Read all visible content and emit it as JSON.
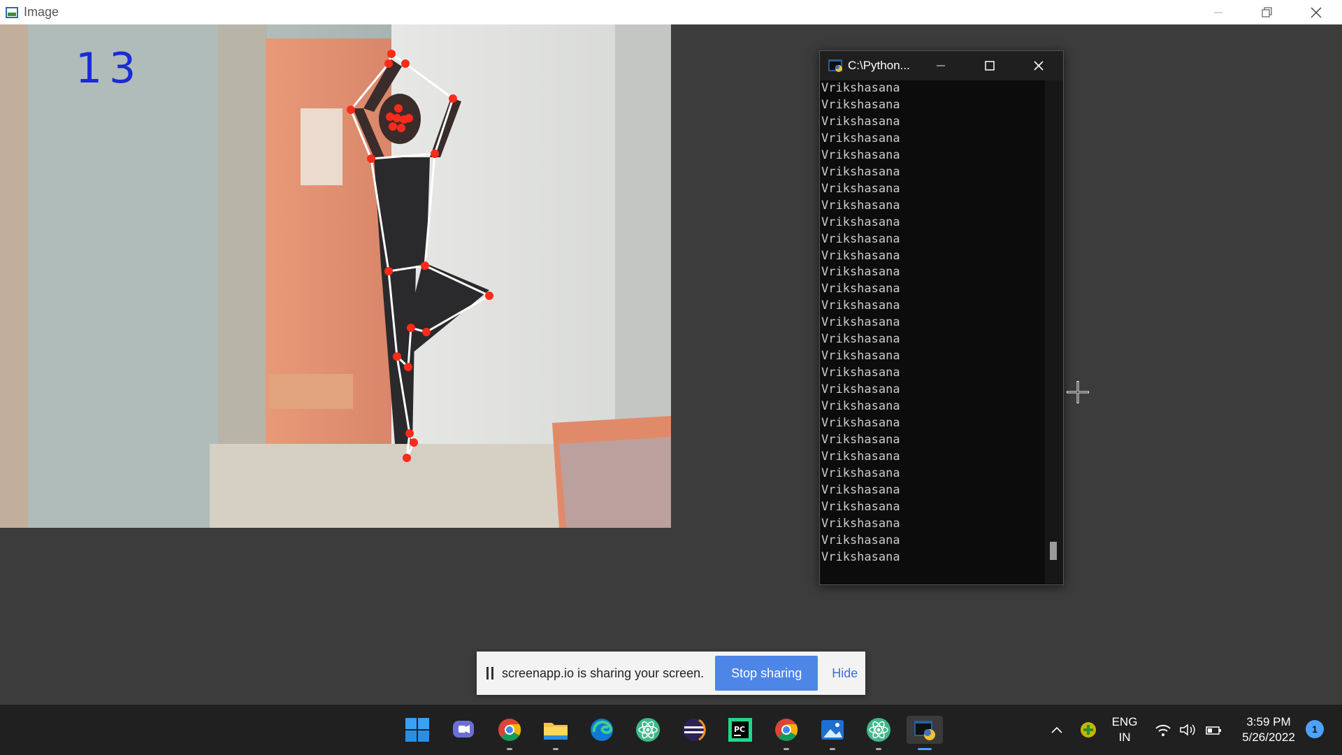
{
  "window": {
    "title": "Image",
    "icon": "image-window-icon",
    "controls": [
      "minimize-icon",
      "restore-icon",
      "close-icon"
    ]
  },
  "camera": {
    "counter": "13",
    "icon": "pose-skeleton-overlay"
  },
  "console": {
    "title": "C:\\Python...",
    "icon": "python-console-icon",
    "lines": [
      "Vrikshasana",
      "Vrikshasana",
      "Vrikshasana",
      "Vrikshasana",
      "Vrikshasana",
      "Vrikshasana",
      "Vrikshasana",
      "Vrikshasana",
      "Vrikshasana",
      "Vrikshasana",
      "Vrikshasana",
      "Vrikshasana",
      "Vrikshasana",
      "Vrikshasana",
      "Vrikshasana",
      "Vrikshasana",
      "Vrikshasana",
      "Vrikshasana",
      "Vrikshasana",
      "Vrikshasana",
      "Vrikshasana",
      "Vrikshasana",
      "Vrikshasana",
      "Vrikshasana",
      "Vrikshasana",
      "Vrikshasana",
      "Vrikshasana",
      "Vrikshasana",
      "Vrikshasana"
    ]
  },
  "share_banner": {
    "text": "screenapp.io is sharing your screen.",
    "stop_label": "Stop sharing",
    "hide_label": "Hide"
  },
  "taskbar": {
    "apps": [
      "windows-start-icon",
      "teams-chat-icon",
      "chrome-icon",
      "file-explorer-icon",
      "edge-icon",
      "atom-icon",
      "eclipse-icon",
      "pycharm-icon",
      "chrome-icon",
      "photos-icon",
      "atom-icon",
      "python-icon"
    ],
    "lang_line1": "ENG",
    "lang_line2": "IN",
    "time": "3:59 PM",
    "date": "5/26/2022",
    "notification_count": "1"
  },
  "colors": {
    "counter": "#1a2bd6",
    "skeleton_joint": "#ff2a1a",
    "skeleton_line": "#ffffff",
    "stop_button": "#4e86e8"
  }
}
